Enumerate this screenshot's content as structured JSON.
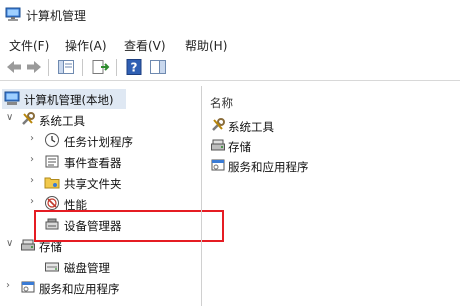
{
  "window": {
    "title": "计算机管理"
  },
  "menu": [
    "文件(F)",
    "操作(A)",
    "查看(V)",
    "帮助(H)"
  ],
  "tree": {
    "root": "计算机管理(本地)",
    "system_tools": "系统工具",
    "task_scheduler": "任务计划程序",
    "event_viewer": "事件查看器",
    "shared_folders": "共享文件夹",
    "performance": "性能",
    "device_manager": "设备管理器",
    "storage": "存储",
    "disk_management": "磁盘管理",
    "services_apps": "服务和应用程序"
  },
  "right": {
    "header": "名称",
    "items": [
      "系统工具",
      "存储",
      "服务和应用程序"
    ]
  },
  "colors": {
    "highlight": "#e51c23",
    "selection": "#dfe8f3"
  }
}
